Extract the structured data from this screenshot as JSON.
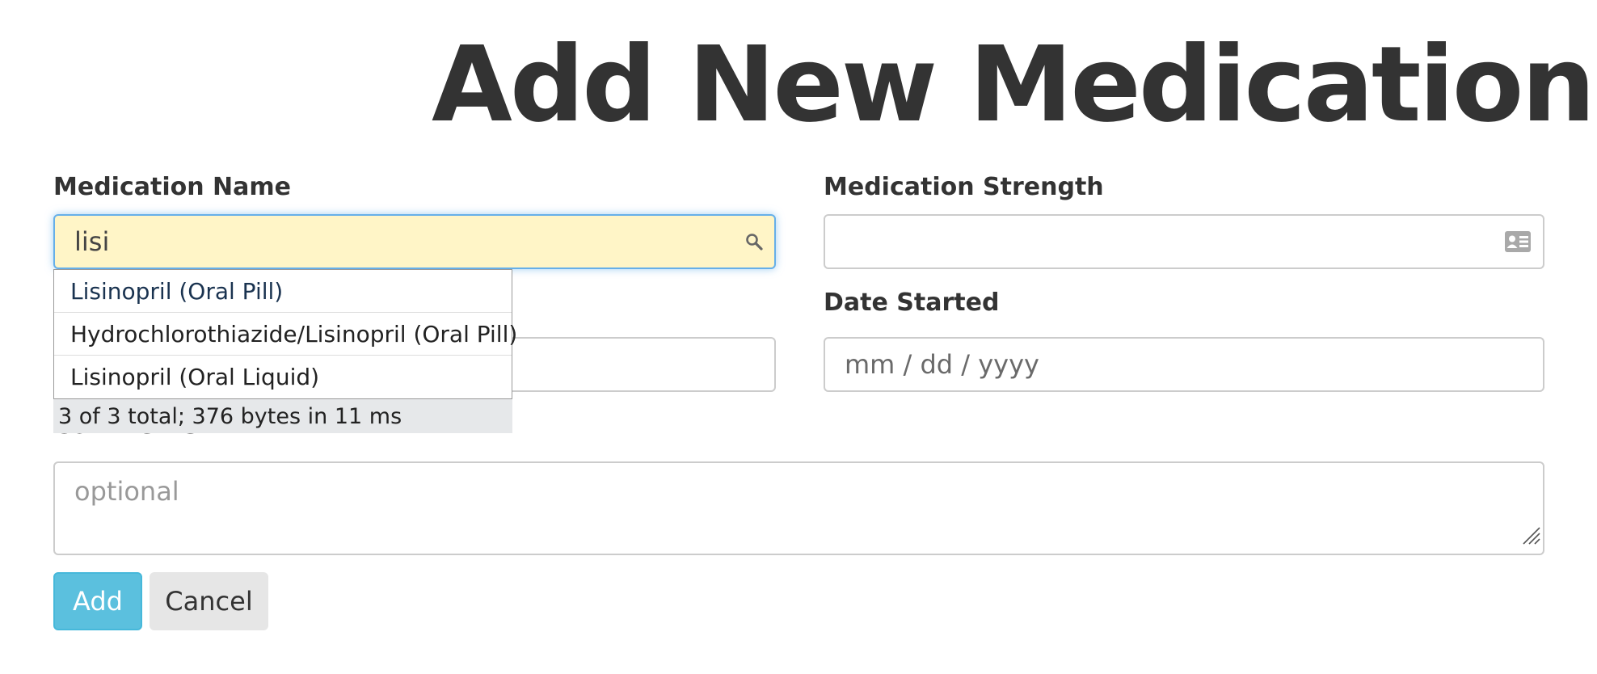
{
  "page": {
    "title": "Add New Medication"
  },
  "form": {
    "medication_name": {
      "label": "Medication Name",
      "value": "lisi"
    },
    "medication_strength": {
      "label": "Medication Strength",
      "value": ""
    },
    "date_started": {
      "label": "Date Started",
      "placeholder": "mm / dd / yyyy"
    },
    "comments": {
      "label": "Comments",
      "placeholder": "optional"
    },
    "buttons": {
      "add": "Add",
      "cancel": "Cancel"
    }
  },
  "autocomplete": {
    "items": [
      {
        "label": "Lisinopril (Oral Pill)"
      },
      {
        "label": "Hydrochlorothiazide/Lisinopril (Oral Pill)"
      },
      {
        "label": "Lisinopril (Oral Liquid)"
      }
    ],
    "status": "3 of 3 total; 376 bytes in 11 ms"
  },
  "icons": {
    "search": "search-icon",
    "contact_card": "contact-card-icon",
    "resize": "resize-grip-icon"
  },
  "colors": {
    "focused_input_bg": "#fff5c7",
    "focus_border": "#66afe9",
    "add_button": "#5bc0de",
    "cancel_button": "#e6e6e6",
    "text": "#333333"
  }
}
